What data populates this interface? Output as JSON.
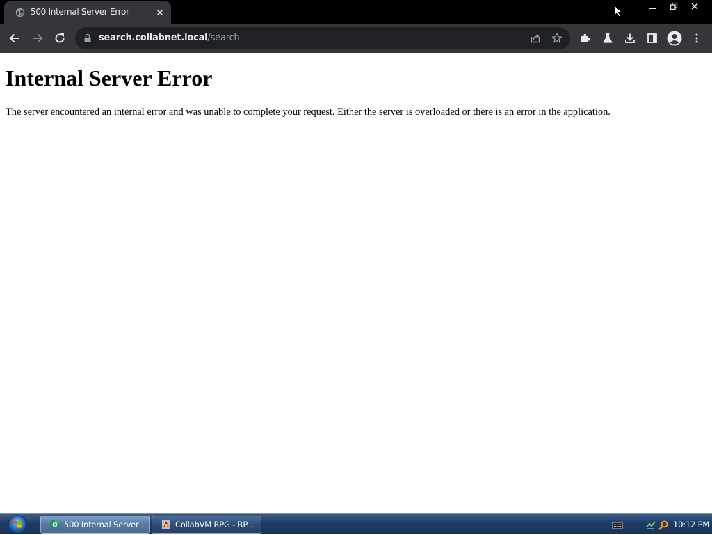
{
  "browser": {
    "tab": {
      "title": "500 Internal Server Error",
      "favicon": "globe-icon"
    },
    "window_controls": [
      "minimize-icon",
      "restore-icon",
      "close-icon"
    ],
    "toolbar": {
      "back": "arrow-left-icon",
      "forward": "arrow-right-icon",
      "reload": "reload-icon",
      "url_host": "search.collabnet.local",
      "url_path": "/search",
      "omnibox_icons": [
        "share-icon",
        "star-icon"
      ],
      "extension_icons": [
        "puzzle-icon",
        "flask-icon",
        "download-icon",
        "side-panel-icon",
        "profile-icon",
        "kebab-menu-icon"
      ]
    }
  },
  "page": {
    "heading": "Internal Server Error",
    "message": "The server encountered an internal error and was unable to complete your request. Either the server is overloaded or there is an error in the application."
  },
  "taskbar": {
    "start": "windows-orb-icon",
    "items": [
      {
        "label": "500 Internal Server ...",
        "active": true
      },
      {
        "label": "CollabVM RPG - RP...",
        "active": false
      }
    ],
    "tray_icons": [
      "keyboard-icon",
      "network-icon",
      "search-icon"
    ],
    "clock": "10:12 PM"
  },
  "colors": {
    "tabstrip_bg": "#000000",
    "toolbar_bg": "#35363a",
    "omnibox_bg": "#202124",
    "taskbar_bg": "#1f3c66"
  }
}
